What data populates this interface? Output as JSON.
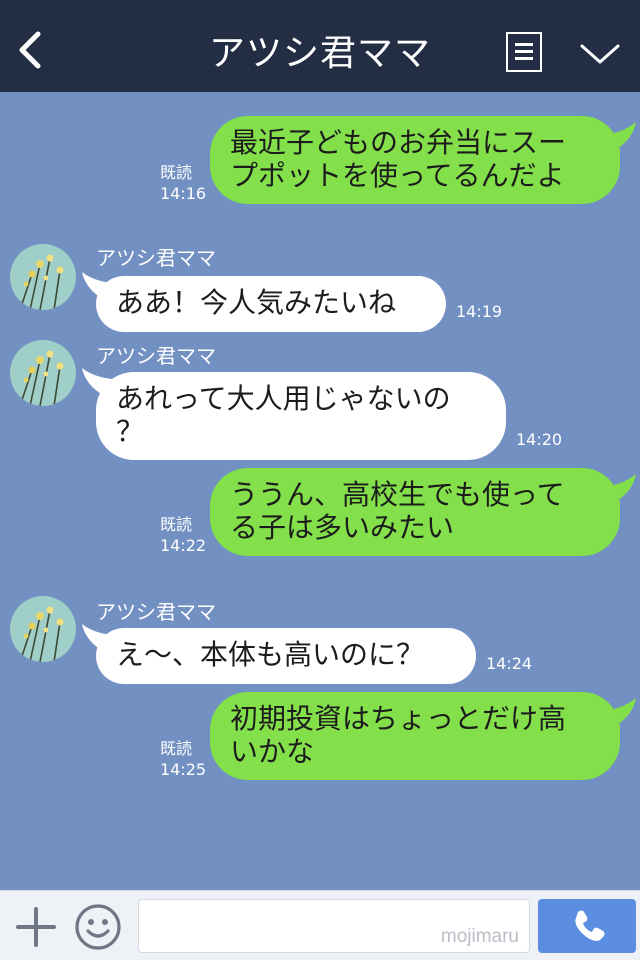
{
  "header": {
    "title": "アツシ君ママ",
    "back_icon": "chevron-left-icon",
    "menu_icon": "notes-icon",
    "expand_icon": "chevron-down-icon"
  },
  "messages": [
    {
      "from": "me",
      "text_lines": [
        "最近子どものお弁当にスー",
        "プポットを使ってるんだよ"
      ],
      "read": "既読",
      "time": "14:16"
    },
    {
      "from": "other",
      "sender": "アツシ君ママ",
      "text_lines": [
        "ああ！今人気みたいね"
      ],
      "time": "14:19"
    },
    {
      "from": "other",
      "sender": "アツシ君ママ",
      "text_lines": [
        "あれって大人用じゃないの",
        "？"
      ],
      "time": "14:20"
    },
    {
      "from": "me",
      "text_lines": [
        "ううん、高校生でも使って",
        "る子は多いみたい"
      ],
      "read": "既読",
      "time": "14:22"
    },
    {
      "from": "other",
      "sender": "アツシ君ママ",
      "text_lines": [
        "え～、本体も高いのに？"
      ],
      "time": "14:24"
    },
    {
      "from": "me",
      "text_lines": [
        "初期投資はちょっとだけ高",
        "いかな"
      ],
      "read": "既読",
      "time": "14:25"
    }
  ],
  "input_bar": {
    "plus_icon": "plus-icon",
    "emoji_icon": "smiley-icon",
    "input_value": "",
    "watermark": "mojimaru",
    "call_icon": "phone-icon"
  },
  "colors": {
    "header_bg": "#232e45",
    "chat_bg": "#7290c2",
    "my_bubble": "#84e04a",
    "their_bubble": "#ffffff",
    "call_button": "#5b8ee0"
  }
}
